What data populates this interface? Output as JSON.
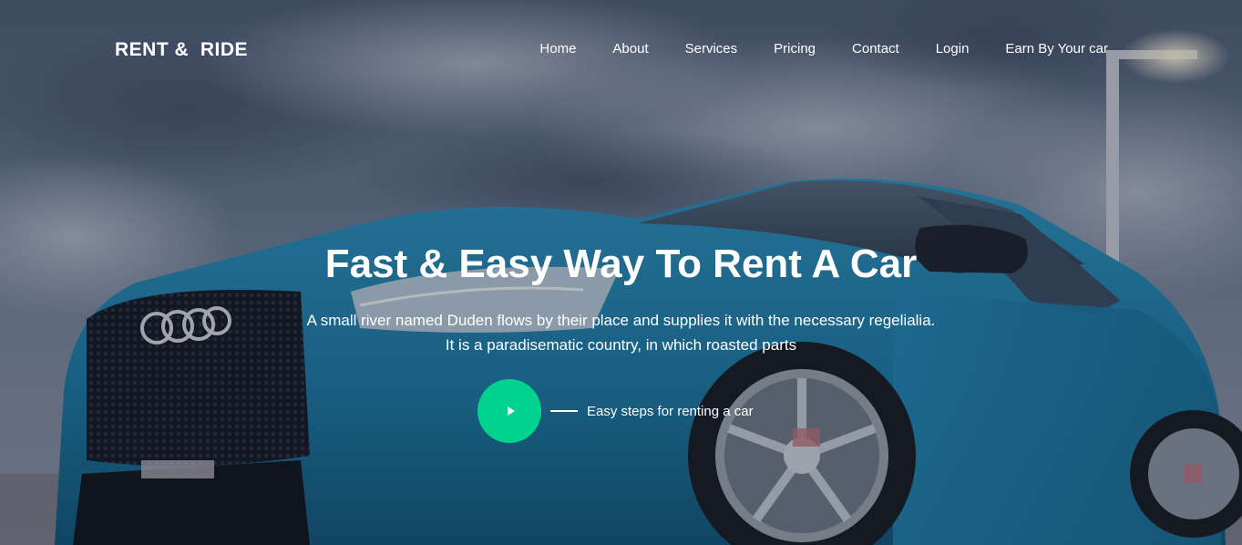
{
  "brand": {
    "name": "RENT &  RIDE"
  },
  "nav": {
    "items": [
      {
        "label": "Home"
      },
      {
        "label": "About"
      },
      {
        "label": "Services"
      },
      {
        "label": "Pricing"
      },
      {
        "label": "Contact"
      },
      {
        "label": "Login"
      },
      {
        "label": "Earn By Your car"
      }
    ]
  },
  "hero": {
    "title": "Fast & Easy Way To Rent A Car",
    "subtitle_line1": "A small river named Duden flows by their place and supplies it with the necessary regelialia.",
    "subtitle_line2": "It is a paradisematic country, in which roasted parts",
    "cta_label": "Easy steps for renting a car",
    "play_icon": "play-icon"
  },
  "colors": {
    "accent": "#01d28e",
    "text": "#ffffff",
    "car": "#1f7fa6",
    "sky": "#5d6b80"
  }
}
